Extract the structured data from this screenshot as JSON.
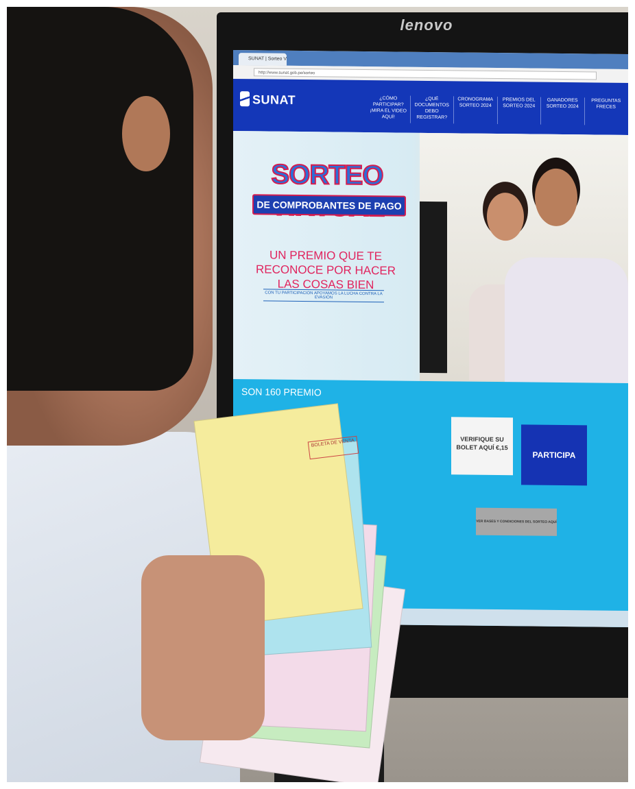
{
  "monitor": {
    "brand": "lenovo"
  },
  "browser": {
    "tab_title": "SUNAT | Sorteo Virtual",
    "url": "http://www.sunat.gob.pe/sorteo"
  },
  "site": {
    "logo": "SUNAT",
    "nav": [
      {
        "label": "¿CÓMO PARTICIPAR? ¡MIRA EL VIDEO AQUÍ!"
      },
      {
        "label": "¿QUÉ DOCUMENTOS DEBO REGISTRAR?"
      },
      {
        "label": "CRONOGRAMA SORTEO 2024"
      },
      {
        "label": "PREMIOS DEL SORTEO 2024"
      },
      {
        "label": "GANADORES SORTEO 2024"
      },
      {
        "label": "PREGUNTAS FRECES"
      }
    ],
    "hero": {
      "title_line1": "SORTEO VIRTUAL",
      "title_line2": "DE COMPROBANTES DE PAGO",
      "tagline": "UN PREMIO QUE TE RECONOCE POR HACER LAS COSAS BIEN",
      "subtagline": "CON TU PARTICIPACIÓN APOYAMOS LA LUCHA CONTRA LA EVASIÓN"
    },
    "promo": {
      "premios_text": "SON 160 PREMIO",
      "verify_button": "VERIFIQUE SU BOLET AQUÍ €,15",
      "participa_button": "PARTICIPA",
      "bases_button": "VER BASES Y CONDICIONES DEL SORTEO AQUÍ"
    }
  },
  "receipt": {
    "label": "BOLETA DE VENTA"
  },
  "colors": {
    "sunat_blue": "#1437b8",
    "accent_red": "#e0245e",
    "cyan_band": "#1fb2e6"
  }
}
